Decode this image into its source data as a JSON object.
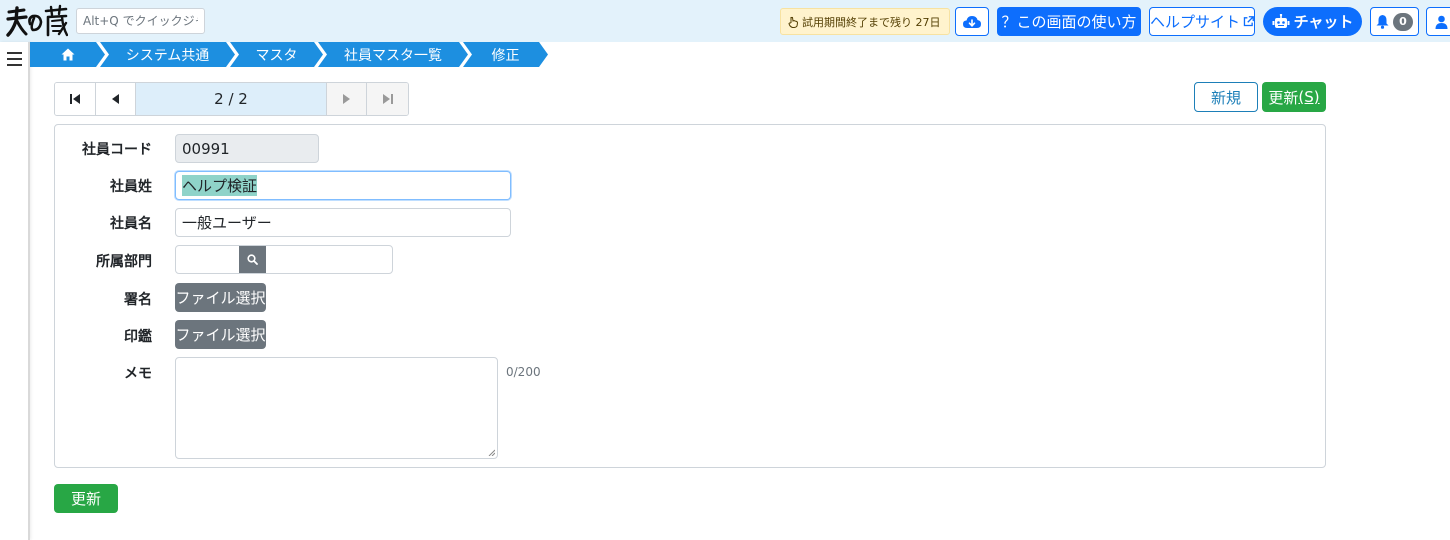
{
  "header": {
    "logo_text": "天の蔵",
    "quickjump_placeholder": "Alt+Q でクイックジャンプ",
    "trial_notice": "試用期間終了まで残り 27日",
    "usage_button": "？この画面の使い方",
    "helpsite_button": "ヘルプサイト",
    "chat_button": "チャット",
    "notification_count": "0",
    "icons": [
      "pointer-hand-icon",
      "cloud-download-icon",
      "external-link-icon",
      "robot-icon",
      "bell-icon",
      "user-icon"
    ]
  },
  "breadcrumb": {
    "items": [
      {
        "label": "",
        "icon": "home-icon"
      },
      {
        "label": "システム共通"
      },
      {
        "label": "マスタ"
      },
      {
        "label": "社員マスタ一覧"
      },
      {
        "label": "修正"
      }
    ],
    "color": "#1d8fe0"
  },
  "pager": {
    "position_text": "2 / 2",
    "icons": [
      "first-page-icon",
      "prev-page-icon",
      "next-page-icon",
      "last-page-icon"
    ]
  },
  "actions": {
    "new_label": "新規",
    "update_label": "更新",
    "update_shortcut": "(S)",
    "bottom_update_label": "更新"
  },
  "form": {
    "employee_code": {
      "label": "社員コード",
      "value": "00991"
    },
    "last_name": {
      "label": "社員姓",
      "value": "ヘルプ検証"
    },
    "first_name": {
      "label": "社員名",
      "value": "一般ユーザー"
    },
    "department": {
      "label": "所属部門",
      "code": "",
      "name": ""
    },
    "signature": {
      "label": "署名",
      "button": "ファイル選択"
    },
    "seal": {
      "label": "印鑑",
      "button": "ファイル選択"
    },
    "memo": {
      "label": "メモ",
      "value": "",
      "counter": "0/200"
    }
  },
  "colors": {
    "header_bg": "#e3f2fb",
    "primary": "#0d6efd",
    "success": "#28a745",
    "secondary": "#6c757d",
    "selection": "#8fd3c9"
  }
}
